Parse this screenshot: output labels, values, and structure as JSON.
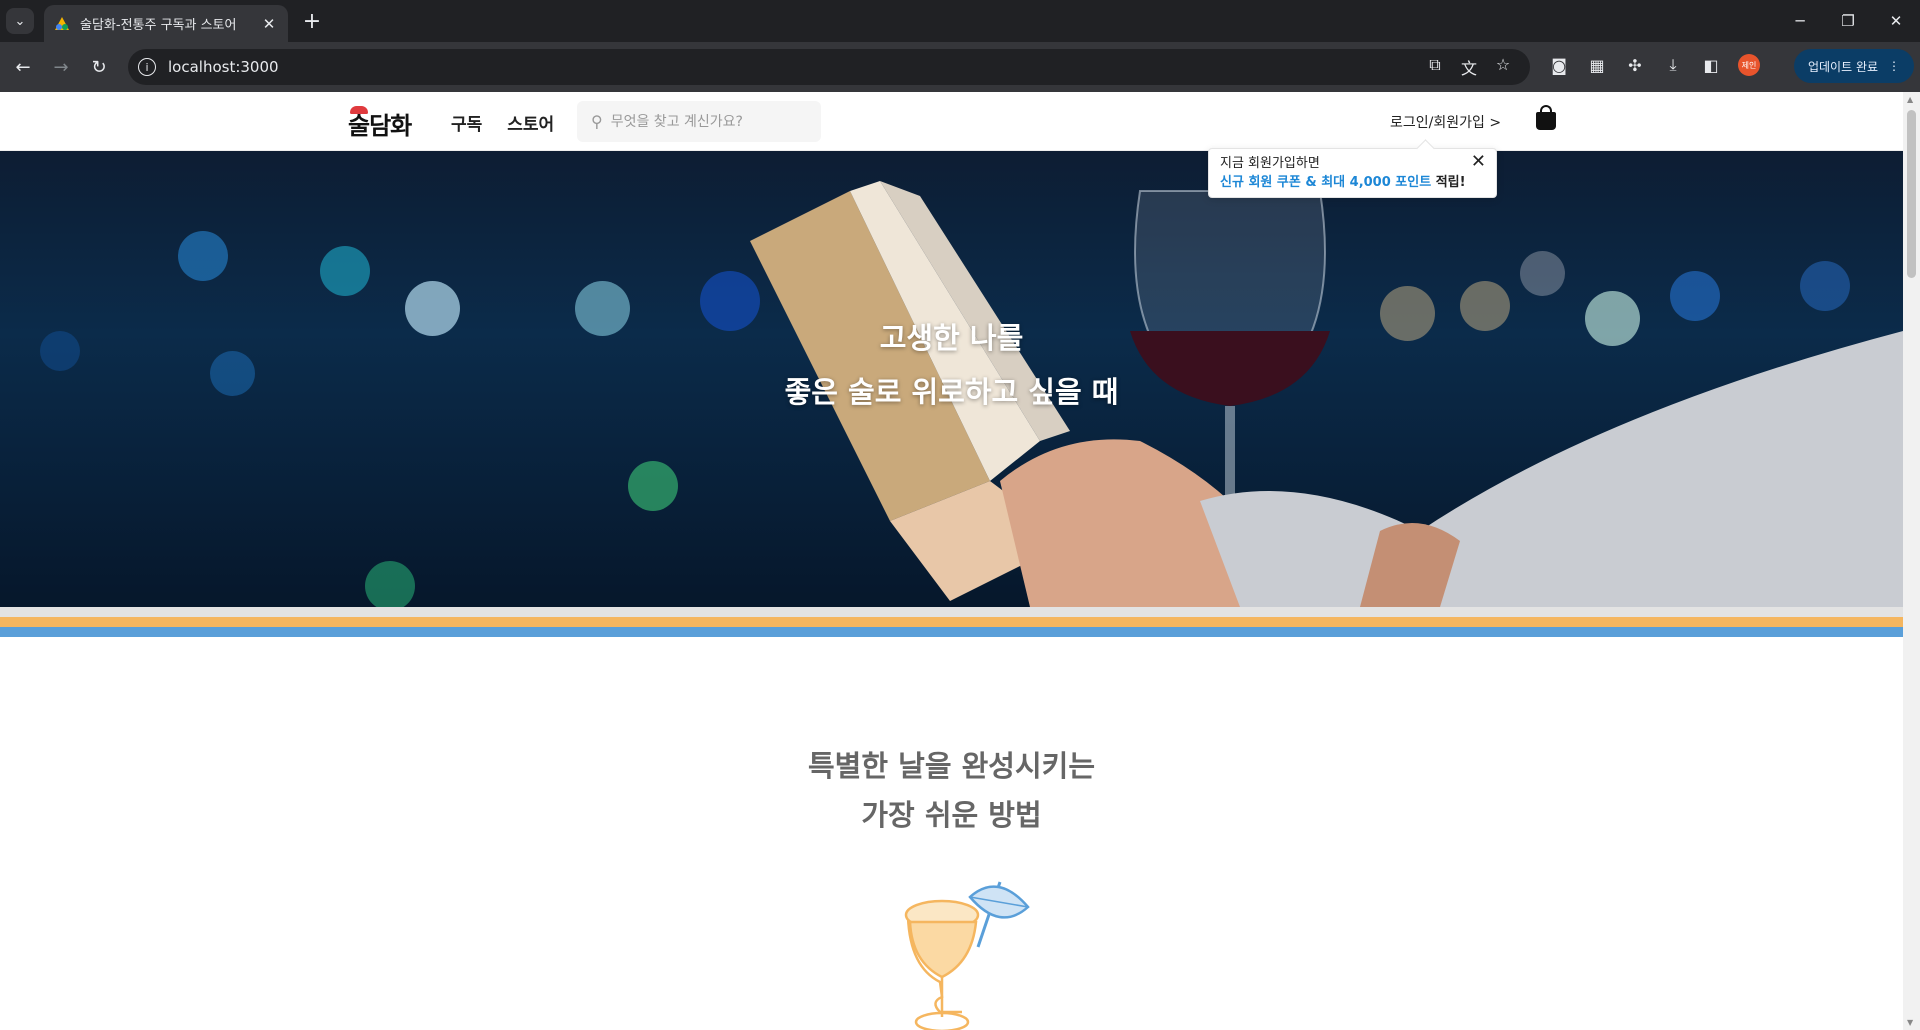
{
  "browser": {
    "tab_title": "술담화-전통주 구독과 스토어",
    "tab_close": "✕",
    "new_tab": "+",
    "url": "localhost:3000",
    "profile_label": "제인",
    "update_label": "업데이트 완료",
    "win_min": "─",
    "win_restore": "❐",
    "win_close": "✕"
  },
  "header": {
    "logo": "술담화",
    "nav": [
      "구독",
      "스토어"
    ],
    "search_placeholder": "무엇을 찾고 계신가요?",
    "login": "로그인/회원가입 >"
  },
  "tooltip": {
    "line1": "지금 회원가입하면",
    "highlight": "신규 회원 쿠폰 & 최대 4,000 포인트",
    "rest": " 적립!"
  },
  "hero": {
    "line1": "고생한 나를",
    "line2": "좋은 술로 위로하고 싶을 때"
  },
  "intro": {
    "line1": "특별한 날을 완성시키는",
    "line2": "가장 쉬운 방법"
  },
  "colors": {
    "stripe_gray": "#e3e3e3",
    "stripe_orange": "#f5b65f",
    "stripe_blue": "#5a9fd9",
    "tooltip_highlight": "#1d87d6"
  }
}
